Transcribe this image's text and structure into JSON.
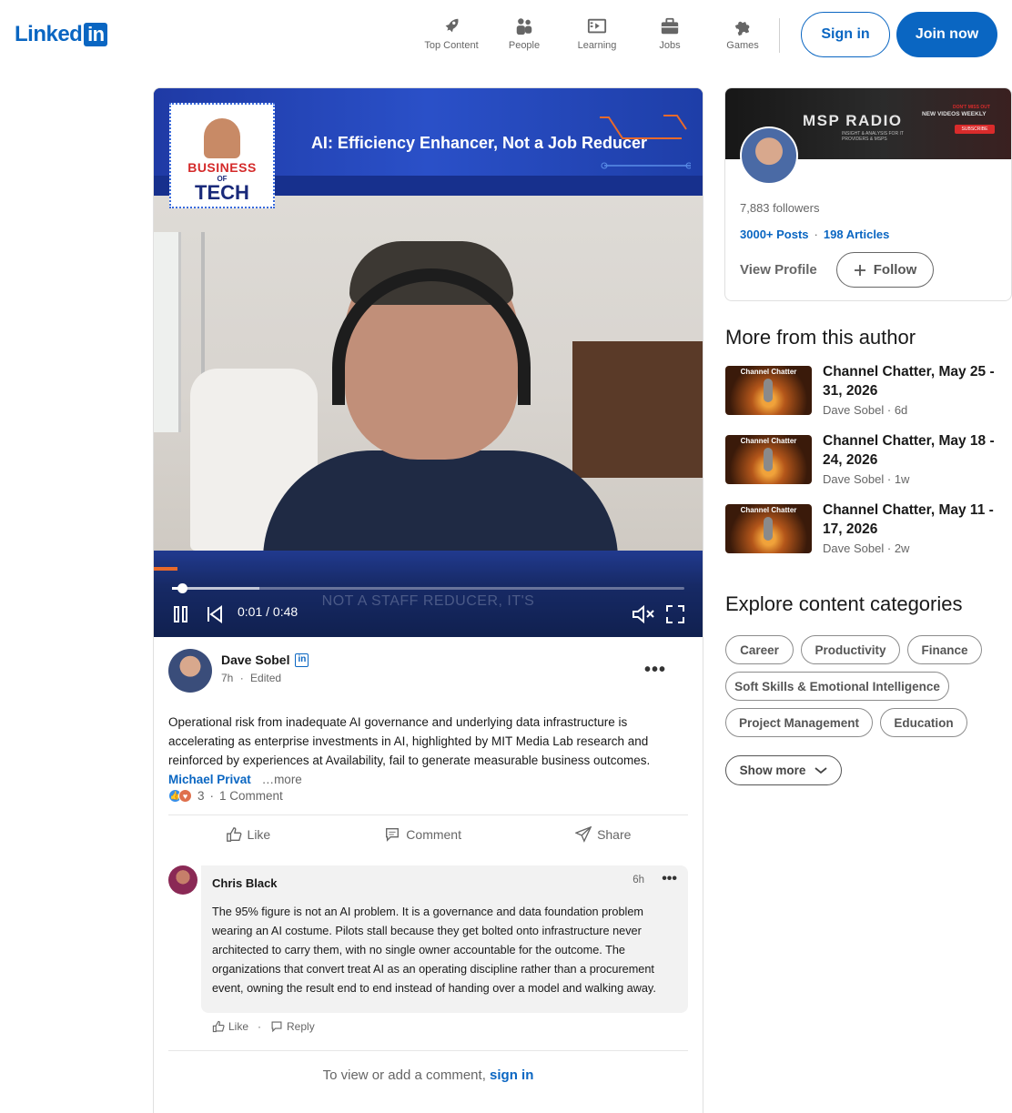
{
  "header": {
    "logo_text": "Linked",
    "logo_box": "in",
    "nav": [
      {
        "label": "Top Content",
        "icon": "rocket-icon"
      },
      {
        "label": "People",
        "icon": "people-icon"
      },
      {
        "label": "Learning",
        "icon": "learning-icon"
      },
      {
        "label": "Jobs",
        "icon": "briefcase-icon"
      },
      {
        "label": "Games",
        "icon": "puzzle-icon"
      }
    ],
    "signin_label": "Sign in",
    "join_label": "Join now",
    "brand_color": "#0a66c2"
  },
  "video": {
    "banner_title": "AI: Efficiency Enhancer, Not a Job Reducer",
    "show_logo": {
      "line1": "BUSINESS",
      "line2": "OF",
      "line3": "TECH"
    },
    "caption": "NOT A STAFF REDUCER, IT'S",
    "time": "0:01 / 0:48",
    "progress_fraction": 0.02
  },
  "post": {
    "author_name": "Dave Sobel",
    "author_badge": "in",
    "meta_time": "7h",
    "meta_sep": "·",
    "meta_edited": "Edited",
    "more_dots": "•••",
    "text": "Operational risk from inadequate AI governance and underlying data infrastructure is accelerating as enterprise investments in AI, highlighted by MIT Media Lab research and reinforced by experiences at Availability, fail to generate measurable business outcomes. ",
    "mention": "Michael Privat",
    "more_link": "…more",
    "reaction_count": "3",
    "reaction_sep": "·",
    "comments_count": "1 Comment",
    "actions": {
      "like": "Like",
      "comment": "Comment",
      "share": "Share"
    }
  },
  "comment": {
    "name": "Chris Black",
    "time": "6h",
    "dots": "•••",
    "body": "The 95% figure is not an AI problem. It is a governance and data foundation problem wearing an AI costume. Pilots stall because they get bolted onto infrastructure never architected to carry them, with no single owner accountable for the outcome. The organizations that convert treat AI as an operating discipline rather than a procurement event, owning the result end to end instead of handing over a model and walking away.",
    "like": "Like",
    "sep": "·",
    "reply": "Reply"
  },
  "signin_prompt": {
    "text": "To view or add a comment, ",
    "link": "sign in"
  },
  "profile": {
    "banner_title": "MSP RADIO",
    "banner_sub": "INSIGHT & ANALYSIS FOR IT PROVIDERS & MSPS",
    "banner_weekly": "NEW VIDEOS WEEKLY",
    "banner_dont_miss": "DON'T MISS OUT",
    "banner_subscribe": "SUBSCRIBE",
    "followers": "7,883 followers",
    "posts": "3000+ Posts",
    "stats_sep": "·",
    "articles": "198 Articles",
    "view_profile": "View Profile",
    "follow": "Follow"
  },
  "more_from_author": {
    "title": "More from this author",
    "items": [
      {
        "thumb_title": "Channel Chatter",
        "title": "Channel Chatter, May 25 - 31, 2026",
        "author": "Dave Sobel",
        "sep": "·",
        "age": "6d"
      },
      {
        "thumb_title": "Channel Chatter",
        "title": "Channel Chatter, May 18 - 24, 2026",
        "author": "Dave Sobel",
        "sep": "·",
        "age": "1w"
      },
      {
        "thumb_title": "Channel Chatter",
        "title": "Channel Chatter, May 11 - 17, 2026",
        "author": "Dave Sobel",
        "sep": "·",
        "age": "2w"
      }
    ]
  },
  "categories": {
    "title": "Explore content categories",
    "chips": [
      "Career",
      "Productivity",
      "Finance",
      "Soft Skills & Emotional Intelligence",
      "Project Management",
      "Education"
    ],
    "show_more": "Show more"
  }
}
